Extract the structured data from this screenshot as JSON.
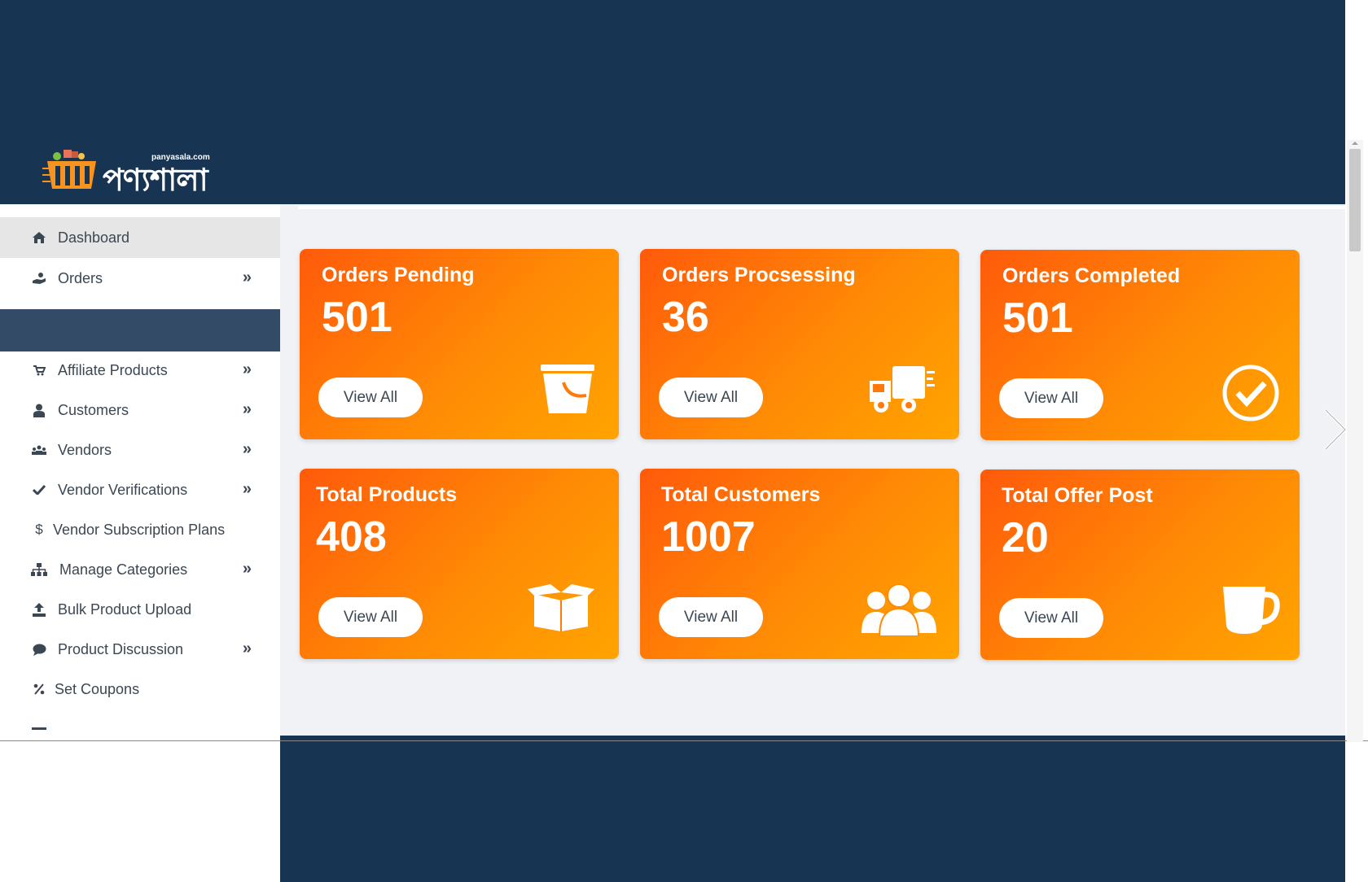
{
  "brand": {
    "domain": "panyasala.com",
    "name": "পণ্যশালা",
    "accent": "#f7931e"
  },
  "colors": {
    "header_bg": "#183453",
    "sidebar_active_bg": "#e6e6e6",
    "card_gradient_start": "#ff5a0a",
    "card_gradient_end": "#ffa400"
  },
  "sidebar": {
    "items": [
      {
        "label": "Dashboard",
        "icon": "home-icon",
        "has_submenu": false,
        "active": true
      },
      {
        "label": "Orders",
        "icon": "hand-coin-icon",
        "has_submenu": true
      },
      {
        "label": "Affiliate Products",
        "icon": "cart-icon",
        "has_submenu": true
      },
      {
        "label": "Customers",
        "icon": "user-icon",
        "has_submenu": true
      },
      {
        "label": "Vendors",
        "icon": "users-icon",
        "has_submenu": true
      },
      {
        "label": "Vendor Verifications",
        "icon": "check-icon",
        "has_submenu": true
      },
      {
        "label": "Vendor Subscription Plans",
        "icon": "dollar-icon",
        "has_submenu": false
      },
      {
        "label": "Manage Categories",
        "icon": "sitemap-icon",
        "has_submenu": true
      },
      {
        "label": "Bulk Product Upload",
        "icon": "upload-icon",
        "has_submenu": false
      },
      {
        "label": "Product Discussion",
        "icon": "comment-icon",
        "has_submenu": true
      },
      {
        "label": "Set Coupons",
        "icon": "percent-icon",
        "has_submenu": false
      }
    ],
    "submenu_chevron": "»"
  },
  "cards": [
    {
      "title": "Orders Pending",
      "value": "501",
      "button": "View All",
      "icon": "bucket-icon"
    },
    {
      "title": "Orders Procsessing",
      "value": "36",
      "button": "View All",
      "icon": "truck-icon"
    },
    {
      "title": "Orders Completed",
      "value": "501",
      "button": "View All",
      "icon": "check-circle-icon"
    },
    {
      "title": "Total Products",
      "value": "408",
      "button": "View All",
      "icon": "box-icon"
    },
    {
      "title": "Total Customers",
      "value": "1007",
      "button": "View All",
      "icon": "users-group-icon"
    },
    {
      "title": "Total Offer Post",
      "value": "20",
      "button": "View All",
      "icon": "mug-icon"
    }
  ]
}
